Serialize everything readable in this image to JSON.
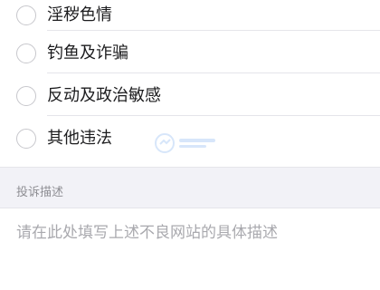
{
  "report_options": [
    {
      "label": "淫秽色情",
      "selected": false
    },
    {
      "label": "钓鱼及诈骗",
      "selected": false
    },
    {
      "label": "反动及政治敏感",
      "selected": false
    },
    {
      "label": "其他违法",
      "selected": false
    }
  ],
  "description_section": {
    "header": "投诉描述",
    "placeholder": "请在此处填写上述不良网站的具体描述",
    "value": ""
  },
  "colors": {
    "radio_border": "#c7c7cc",
    "text": "#1c1c1e",
    "section_bg": "#f2f2f7",
    "section_text": "#8e8e93",
    "placeholder": "#a9a9ae"
  }
}
